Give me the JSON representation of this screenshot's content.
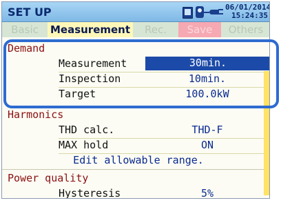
{
  "title": "SET UP",
  "datetime": {
    "date": "06/01/2014",
    "time": "15:24:35"
  },
  "status_icons": [
    "sd-card-icon",
    "usb-icon",
    "power-plug-icon"
  ],
  "tabs": [
    {
      "label": "Basic",
      "active": false
    },
    {
      "label": "Measurement",
      "active": true
    },
    {
      "label": "Rec.",
      "active": false
    },
    {
      "label": "Save",
      "active": false
    },
    {
      "label": "Others",
      "active": false
    }
  ],
  "demand": {
    "heading": "Demand",
    "rows": [
      {
        "label": "Measurement",
        "value": "30min."
      },
      {
        "label": "Inspection",
        "value": "10min."
      },
      {
        "label": "Target",
        "value": "100.0kW"
      }
    ]
  },
  "harmonics": {
    "heading": "Harmonics",
    "rows": [
      {
        "label": "THD calc.",
        "value": "THD-F"
      },
      {
        "label": "MAX hold",
        "value": "ON"
      }
    ],
    "link": "Edit allowable range."
  },
  "power_quality": {
    "heading": "Power quality",
    "rows": [
      {
        "label": "Hysteresis",
        "value": "5%"
      }
    ]
  },
  "colors": {
    "accent": "#2d6bd1",
    "selection": "#1c4aa8",
    "section_heading": "#8a1010",
    "active_tab": "#fff7b8",
    "save_tab": "#f6a9b2"
  }
}
